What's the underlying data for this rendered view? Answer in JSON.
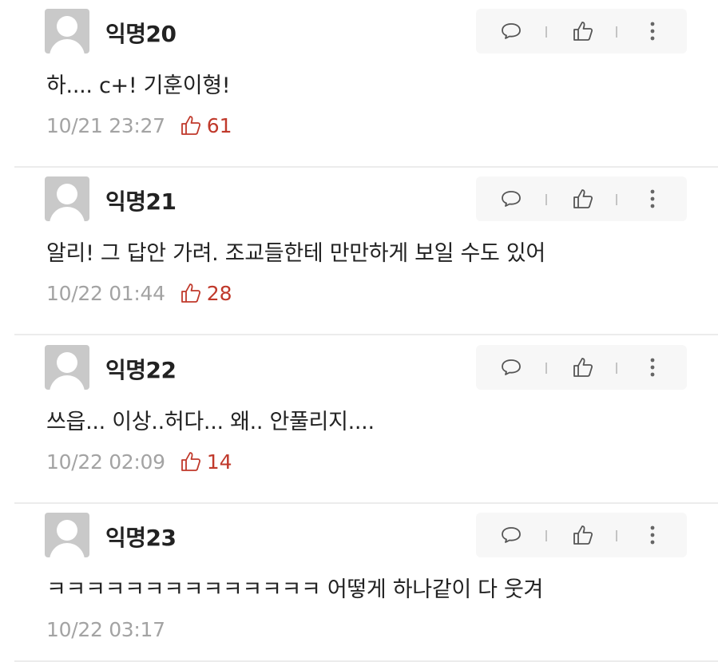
{
  "comments": [
    {
      "nickname": "익명20",
      "content": "하.... c+! 기훈이형!",
      "timestamp": "10/21 23:27",
      "votes": "61"
    },
    {
      "nickname": "익명21",
      "content": "알리! 그 답안 가려. 조교들한테 만만하게 보일 수도 있어",
      "timestamp": "10/22 01:44",
      "votes": "28"
    },
    {
      "nickname": "익명22",
      "content": "쓰읍... 이상..허다... 왜.. 안풀리지....",
      "timestamp": "10/22 02:09",
      "votes": "14"
    },
    {
      "nickname": "익명23",
      "content": "ㅋㅋㅋㅋㅋㅋㅋㅋㅋㅋㅋㅋㅋㅋ 어떻게 하나같이 다 웃겨",
      "timestamp": "10/22 03:17",
      "votes": ""
    }
  ],
  "icons": {
    "reply": "speech-bubble-icon",
    "like": "thumbs-up-icon",
    "more": "vertical-dots-icon"
  },
  "colors": {
    "vote": "#c0392b",
    "timestamp": "#a3a3a3",
    "actions_bg": "#f7f7f7",
    "avatar_bg": "#c9c9c9"
  }
}
